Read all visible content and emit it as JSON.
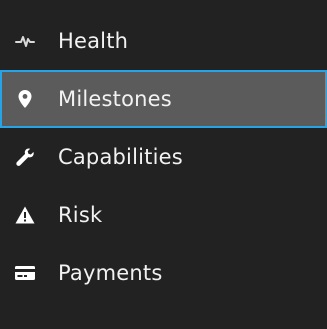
{
  "menu": {
    "items": [
      {
        "label": "Health",
        "icon": "pulse-icon",
        "active": false
      },
      {
        "label": "Milestones",
        "icon": "map-marker-icon",
        "active": true
      },
      {
        "label": "Capabilities",
        "icon": "wrench-icon",
        "active": false
      },
      {
        "label": "Risk",
        "icon": "warning-icon",
        "active": false
      },
      {
        "label": "Payments",
        "icon": "credit-card-icon",
        "active": false
      }
    ]
  },
  "colors": {
    "background": "#222222",
    "active_background": "#5b5b5b",
    "active_border": "#27a4e5",
    "text": "#f2f2f2"
  }
}
